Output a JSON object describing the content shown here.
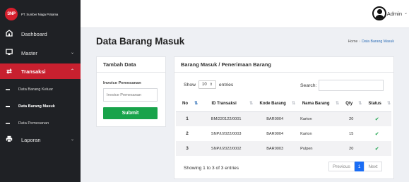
{
  "brand": {
    "logo": "SNP",
    "name": "PT. Sumber Niaga Pratama"
  },
  "sidebar": {
    "items": [
      {
        "label": "Dashboard",
        "icon": "dashboard-icon"
      },
      {
        "label": "Master",
        "icon": "monitor-icon"
      },
      {
        "label": "Transaksi",
        "icon": "swap-icon"
      },
      {
        "label": "Laporan",
        "icon": "printer-icon"
      }
    ],
    "subitems": [
      {
        "label": "Data Barang Keluar"
      },
      {
        "label": "Data Barang Masuk"
      },
      {
        "label": "Data Pemesanan"
      }
    ]
  },
  "topbar": {
    "user": "Admin"
  },
  "page": {
    "title": "Data Barang Masuk",
    "breadcrumb": {
      "home": "Home",
      "current": "Data Barang Masuk"
    }
  },
  "form": {
    "title": "Tambah Data",
    "invoice_label": "Invoice Pemesanan",
    "invoice_placeholder": "Invoice Pemesanan",
    "submit_label": "Submit"
  },
  "table_card": {
    "title": "Barang Masuk / Penerimaan Barang",
    "show_label": "Show",
    "entries_value": "10",
    "entries_label": "entries",
    "search_label": "Search:",
    "columns": [
      "No",
      "ID Transaksi",
      "Kode Barang",
      "Nama Barang",
      "Qty",
      "Status"
    ],
    "rows": [
      {
        "no": "1",
        "id": "BM/220122/0001",
        "kode": "BAR0004",
        "nama": "Karton",
        "qty": "20",
        "status": "check-circle-icon"
      },
      {
        "no": "2",
        "id": "SNP/I/2022/0003",
        "kode": "BAR0004",
        "nama": "Karton",
        "qty": "15",
        "status": "check-circle-icon"
      },
      {
        "no": "3",
        "id": "SNP/I/2022/0002",
        "kode": "BAR0003",
        "nama": "Pulpen",
        "qty": "20",
        "status": "check-circle-icon"
      }
    ],
    "info": "Showing 1 to 3 of 3 entries",
    "pagination": {
      "previous": "Previous",
      "current": "1",
      "next": "Next"
    }
  },
  "colors": {
    "accent": "#c8202f",
    "sidebar_bg": "#1f2125",
    "success": "#18a34a",
    "page_active": "#1a6df5"
  }
}
